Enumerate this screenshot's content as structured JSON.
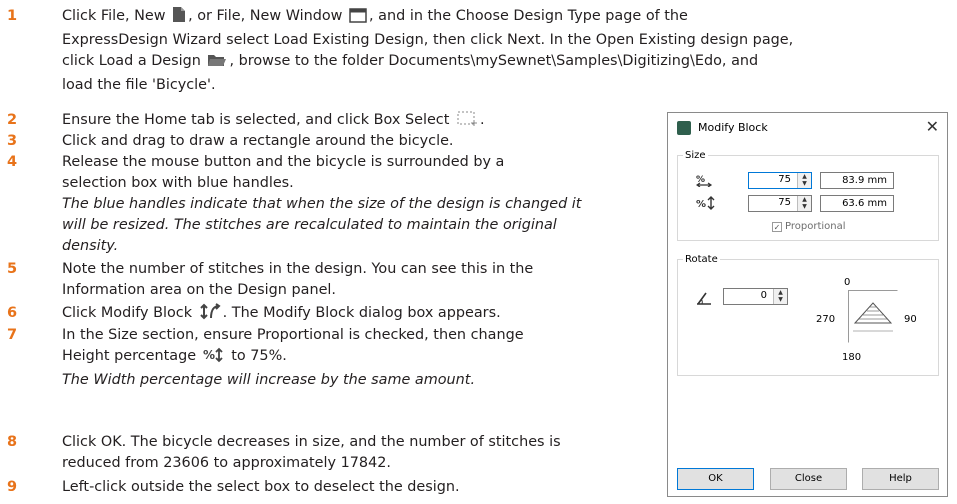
{
  "steps": [
    {
      "num": "1",
      "p1": "Click File, New",
      "p2": ", or File, New Window",
      "p3": ", and in the Choose Design Type page of the",
      "l2": "ExpressDesign Wizard select Load Existing Design, then click Next. In the Open Existing design page,",
      "l3a": "click Load a Design",
      "l3b": ", browse to the folder Documents\\mySewnet\\Samples\\Digitizing\\Edo, and",
      "l4": "load the file 'Bicycle'."
    },
    {
      "num": "2",
      "a": "Ensure the Home tab is selected, and click Box Select",
      "b": "."
    },
    {
      "num": "3",
      "a": "Click and drag to draw a rectangle around the bicycle."
    },
    {
      "num": "4",
      "l1": "Release the mouse button and the bicycle is surrounded by a",
      "l2": "selection box with blue handles.",
      "n1": "The blue handles indicate that when the size of the design is changed it",
      "n2": "will be resized. The stitches are recalculated to maintain the original",
      "n3": "density."
    },
    {
      "num": "5",
      "l1": "Note the number of stitches in the design. You can see this in the",
      "l2": "Information area on the Design panel."
    },
    {
      "num": "6",
      "a": "Click Modify Block",
      "b": ". The Modify Block dialog box appears."
    },
    {
      "num": "7",
      "l1": "In the Size section, ensure Proportional is checked, then change",
      "l2a": "Height percentage",
      "l2b": "to 75%.",
      "n1": "The Width percentage will increase by the same amount."
    },
    {
      "num": "8",
      "l1": "Click OK. The bicycle decreases in size, and the number of stitches is",
      "l2": "reduced from 23606 to approximately 17842."
    },
    {
      "num": "9",
      "a": "Left-click outside the select box to deselect the design."
    }
  ],
  "dialog": {
    "title": "Modify Block",
    "size_label": "Size",
    "width_pct": "75",
    "width_mm": "83.9 mm",
    "height_pct": "75",
    "height_mm": "63.6 mm",
    "proportional_label": "Proportional",
    "rotate_label": "Rotate",
    "rotate_value": "0",
    "angle_0": "0",
    "angle_90": "90",
    "angle_180": "180",
    "angle_270": "270",
    "ok_label": "OK",
    "close_label": "Close",
    "help_label": "Help"
  },
  "colors": {
    "step_number": "#e8731a",
    "focus": "#0078d7"
  },
  "icons": [
    "new-file-icon",
    "new-window-icon",
    "load-design-folder-icon",
    "box-select-icon",
    "modify-block-icon",
    "height-percentage-icon",
    "width-percentage-icon",
    "rotate-angle-icon",
    "close-icon",
    "app-icon"
  ]
}
